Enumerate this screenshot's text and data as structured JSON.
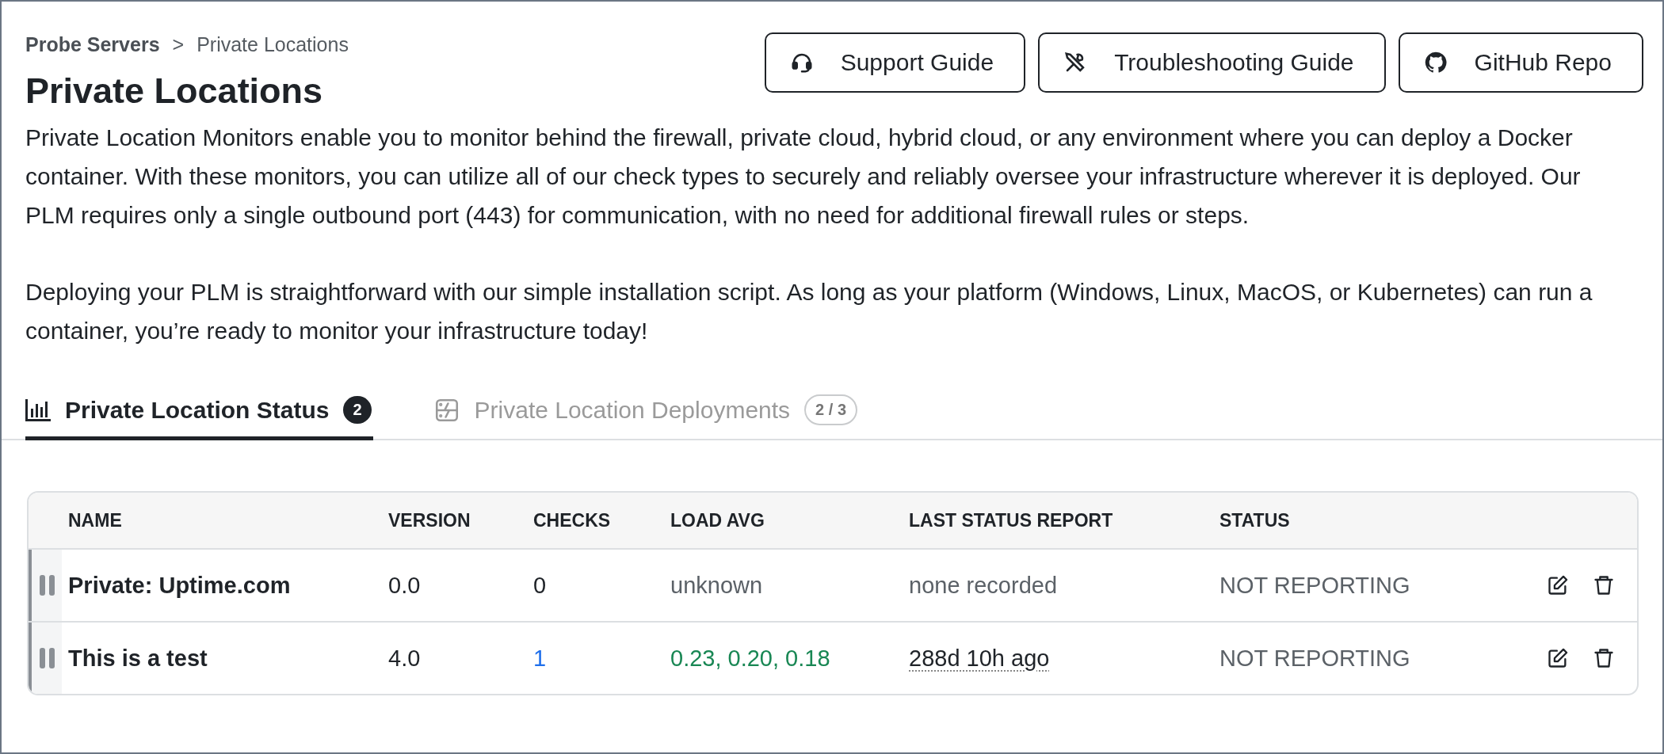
{
  "breadcrumb": {
    "parent": "Probe Servers",
    "separator": ">",
    "current": "Private Locations"
  },
  "title": "Private Locations",
  "header_buttons": [
    {
      "label": "Support Guide"
    },
    {
      "label": "Troubleshooting Guide"
    },
    {
      "label": "GitHub Repo"
    }
  ],
  "description": [
    "Private Location Monitors enable you to monitor behind the firewall, private cloud, hybrid cloud, or any environment where you can deploy a Docker container. With these monitors, you can utilize all of our check types to securely and reliably oversee your infrastructure wherever it is deployed. Our PLM requires only a single outbound port (443) for communication, with no need for additional firewall rules or steps.",
    "Deploying your PLM is straightforward with our simple installation script. As long as your platform (Windows, Linux, MacOS, or Kubernetes) can run a container, you’re ready to monitor your infrastructure today!"
  ],
  "tabs": [
    {
      "label": "Private Location Status",
      "badge": "2",
      "selected": true
    },
    {
      "label": "Private Location Deployments",
      "badge": "2 / 3",
      "selected": false
    }
  ],
  "table": {
    "columns": [
      "NAME",
      "VERSION",
      "CHECKS",
      "LOAD AVG",
      "LAST STATUS REPORT",
      "STATUS"
    ],
    "rows": [
      {
        "name": "Private: Uptime.com",
        "version": "0.0",
        "checks": "0",
        "checks_linked": false,
        "load_avg": "unknown",
        "load_avg_reported": false,
        "last_report": "none recorded",
        "last_report_reported": false,
        "status": "NOT REPORTING"
      },
      {
        "name": "This is a test",
        "version": "4.0",
        "checks": "1",
        "checks_linked": true,
        "load_avg": "0.23, 0.20, 0.18",
        "load_avg_reported": true,
        "last_report": "288d 10h ago",
        "last_report_reported": true,
        "status": "NOT REPORTING"
      }
    ]
  }
}
